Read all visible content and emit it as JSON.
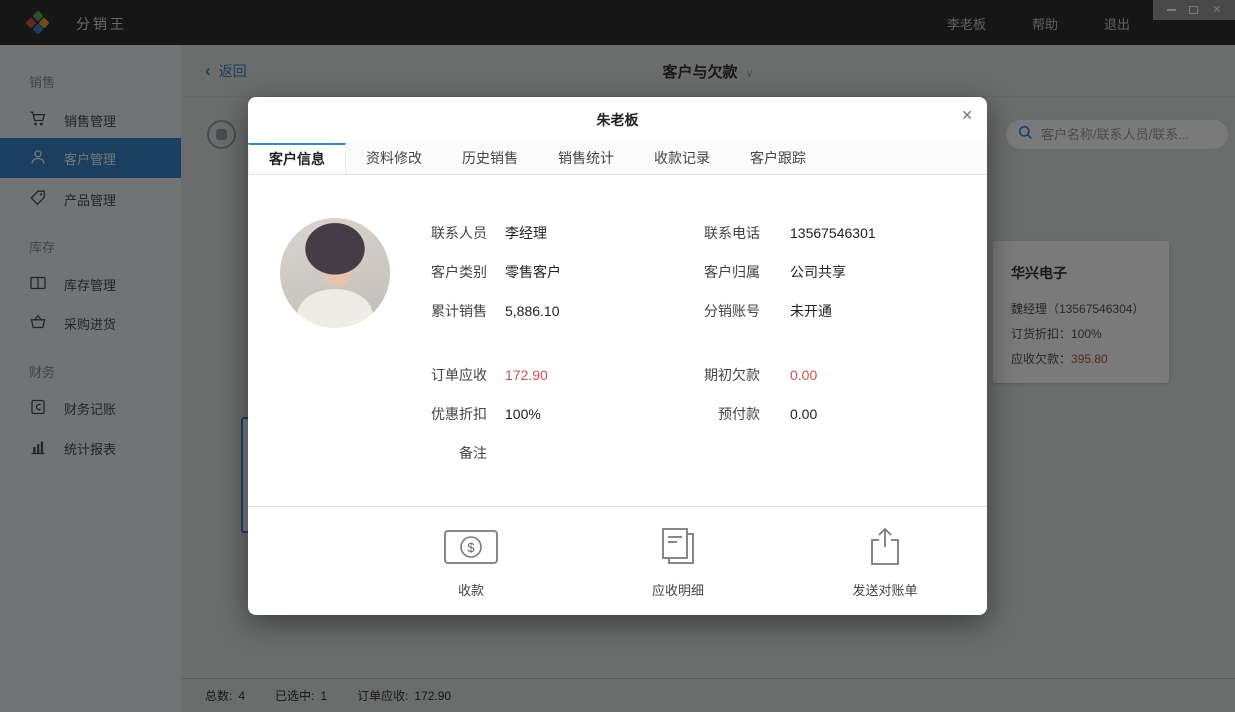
{
  "topbar": {
    "app_title": "分销王",
    "user": "李老板",
    "help": "帮助",
    "logout": "退出"
  },
  "sidebar": {
    "sections": [
      {
        "label": "销售",
        "items": [
          {
            "label": "销售管理"
          },
          {
            "label": "客户管理"
          },
          {
            "label": "产品管理"
          }
        ]
      },
      {
        "label": "库存",
        "items": [
          {
            "label": "库存管理"
          },
          {
            "label": "采购进货"
          }
        ]
      },
      {
        "label": "财务",
        "items": [
          {
            "label": "财务记账"
          },
          {
            "label": "统计报表"
          }
        ]
      }
    ]
  },
  "header": {
    "back_label": "返回",
    "title": "客户与欠款"
  },
  "search": {
    "placeholder": "客户名称/联系人员/联系..."
  },
  "background_card": {
    "name": "华兴电子",
    "contact": "魏经理（13567546304）",
    "discount_label": "订货折扣：",
    "discount_value": "100%",
    "debt_label": "应收欠款：",
    "debt_value": "395.80"
  },
  "status_bar": {
    "total_label": "总数:",
    "total_value": "4",
    "selected_label": "已选中:",
    "selected_value": "1",
    "receivable_label": "订单应收:",
    "receivable_value": "172.90"
  },
  "modal": {
    "title": "朱老板",
    "tabs": [
      {
        "label": "客户信息",
        "active": true
      },
      {
        "label": "资料修改"
      },
      {
        "label": "历史销售"
      },
      {
        "label": "销售统计"
      },
      {
        "label": "收款记录"
      },
      {
        "label": "客户跟踪"
      }
    ],
    "info": {
      "left_top": [
        {
          "label": "联系人员",
          "value": "李经理"
        },
        {
          "label": "客户类别",
          "value": "零售客户"
        },
        {
          "label": "累计销售",
          "value": "5,886.10"
        }
      ],
      "left_bottom": [
        {
          "label": "订单应收",
          "value": "172.90"
        },
        {
          "label": "优惠折扣",
          "value": "100%"
        },
        {
          "label": "备注",
          "value": ""
        }
      ],
      "right_top": [
        {
          "label": "联系电话",
          "value": "13567546301"
        },
        {
          "label": "客户归属",
          "value": "公司共享"
        },
        {
          "label": "分销账号",
          "value": "未开通"
        }
      ],
      "right_bottom": [
        {
          "label": "期初欠款",
          "value": "0.00"
        },
        {
          "label": "预付款",
          "value": "0.00"
        }
      ]
    },
    "actions": [
      {
        "label": "收款"
      },
      {
        "label": "应收明细"
      },
      {
        "label": "发送对账单"
      }
    ]
  },
  "icons": {
    "back_chevron": "‹",
    "title_caret": "∨",
    "modal_close": "✕",
    "win_close": "✕",
    "dollar": "$"
  },
  "colors": {
    "accent": "#3a85c6",
    "danger": "#c9544f",
    "topbar": "#2e2e2e"
  }
}
